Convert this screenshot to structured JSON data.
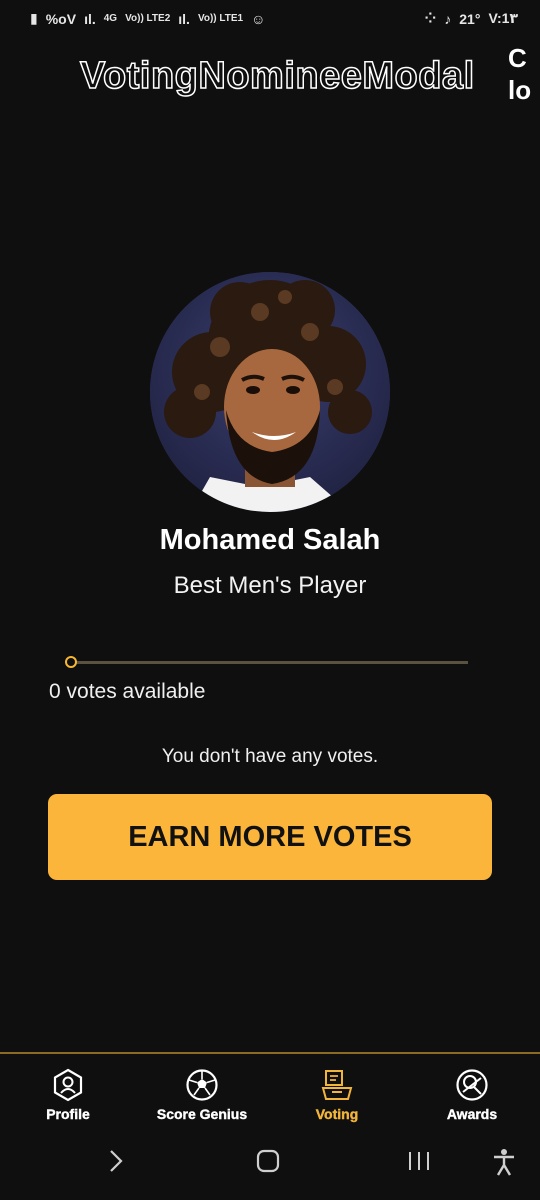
{
  "status_bar": {
    "battery_percent": "%oV",
    "network_4g": "4G",
    "lte2": "Vo)) LTE2",
    "lte1": "Vo)) LTE1",
    "temperature": "21°",
    "time": "V:1٣"
  },
  "header": {
    "title": "VotingNomineeModal",
    "corner_text": "C lo"
  },
  "nominee": {
    "name": "Mohamed Salah",
    "category": "Best Men's Player"
  },
  "votes": {
    "available_text": "0 votes available",
    "slider_value": 0,
    "message": "You don't have any votes."
  },
  "actions": {
    "earn_more_label": "EARN MORE VOTES"
  },
  "bottom_nav": {
    "items": [
      {
        "label": "Profile",
        "icon": "profile-icon"
      },
      {
        "label": "Score Genius",
        "icon": "soccer-ball-icon"
      },
      {
        "label": "Voting",
        "icon": "ballot-box-icon"
      },
      {
        "label": "Awards",
        "icon": "award-icon"
      }
    ],
    "active": "Voting"
  },
  "colors": {
    "accent": "#fbb53a",
    "active_nav": "#f2b53b",
    "background": "#0f0f0f"
  }
}
